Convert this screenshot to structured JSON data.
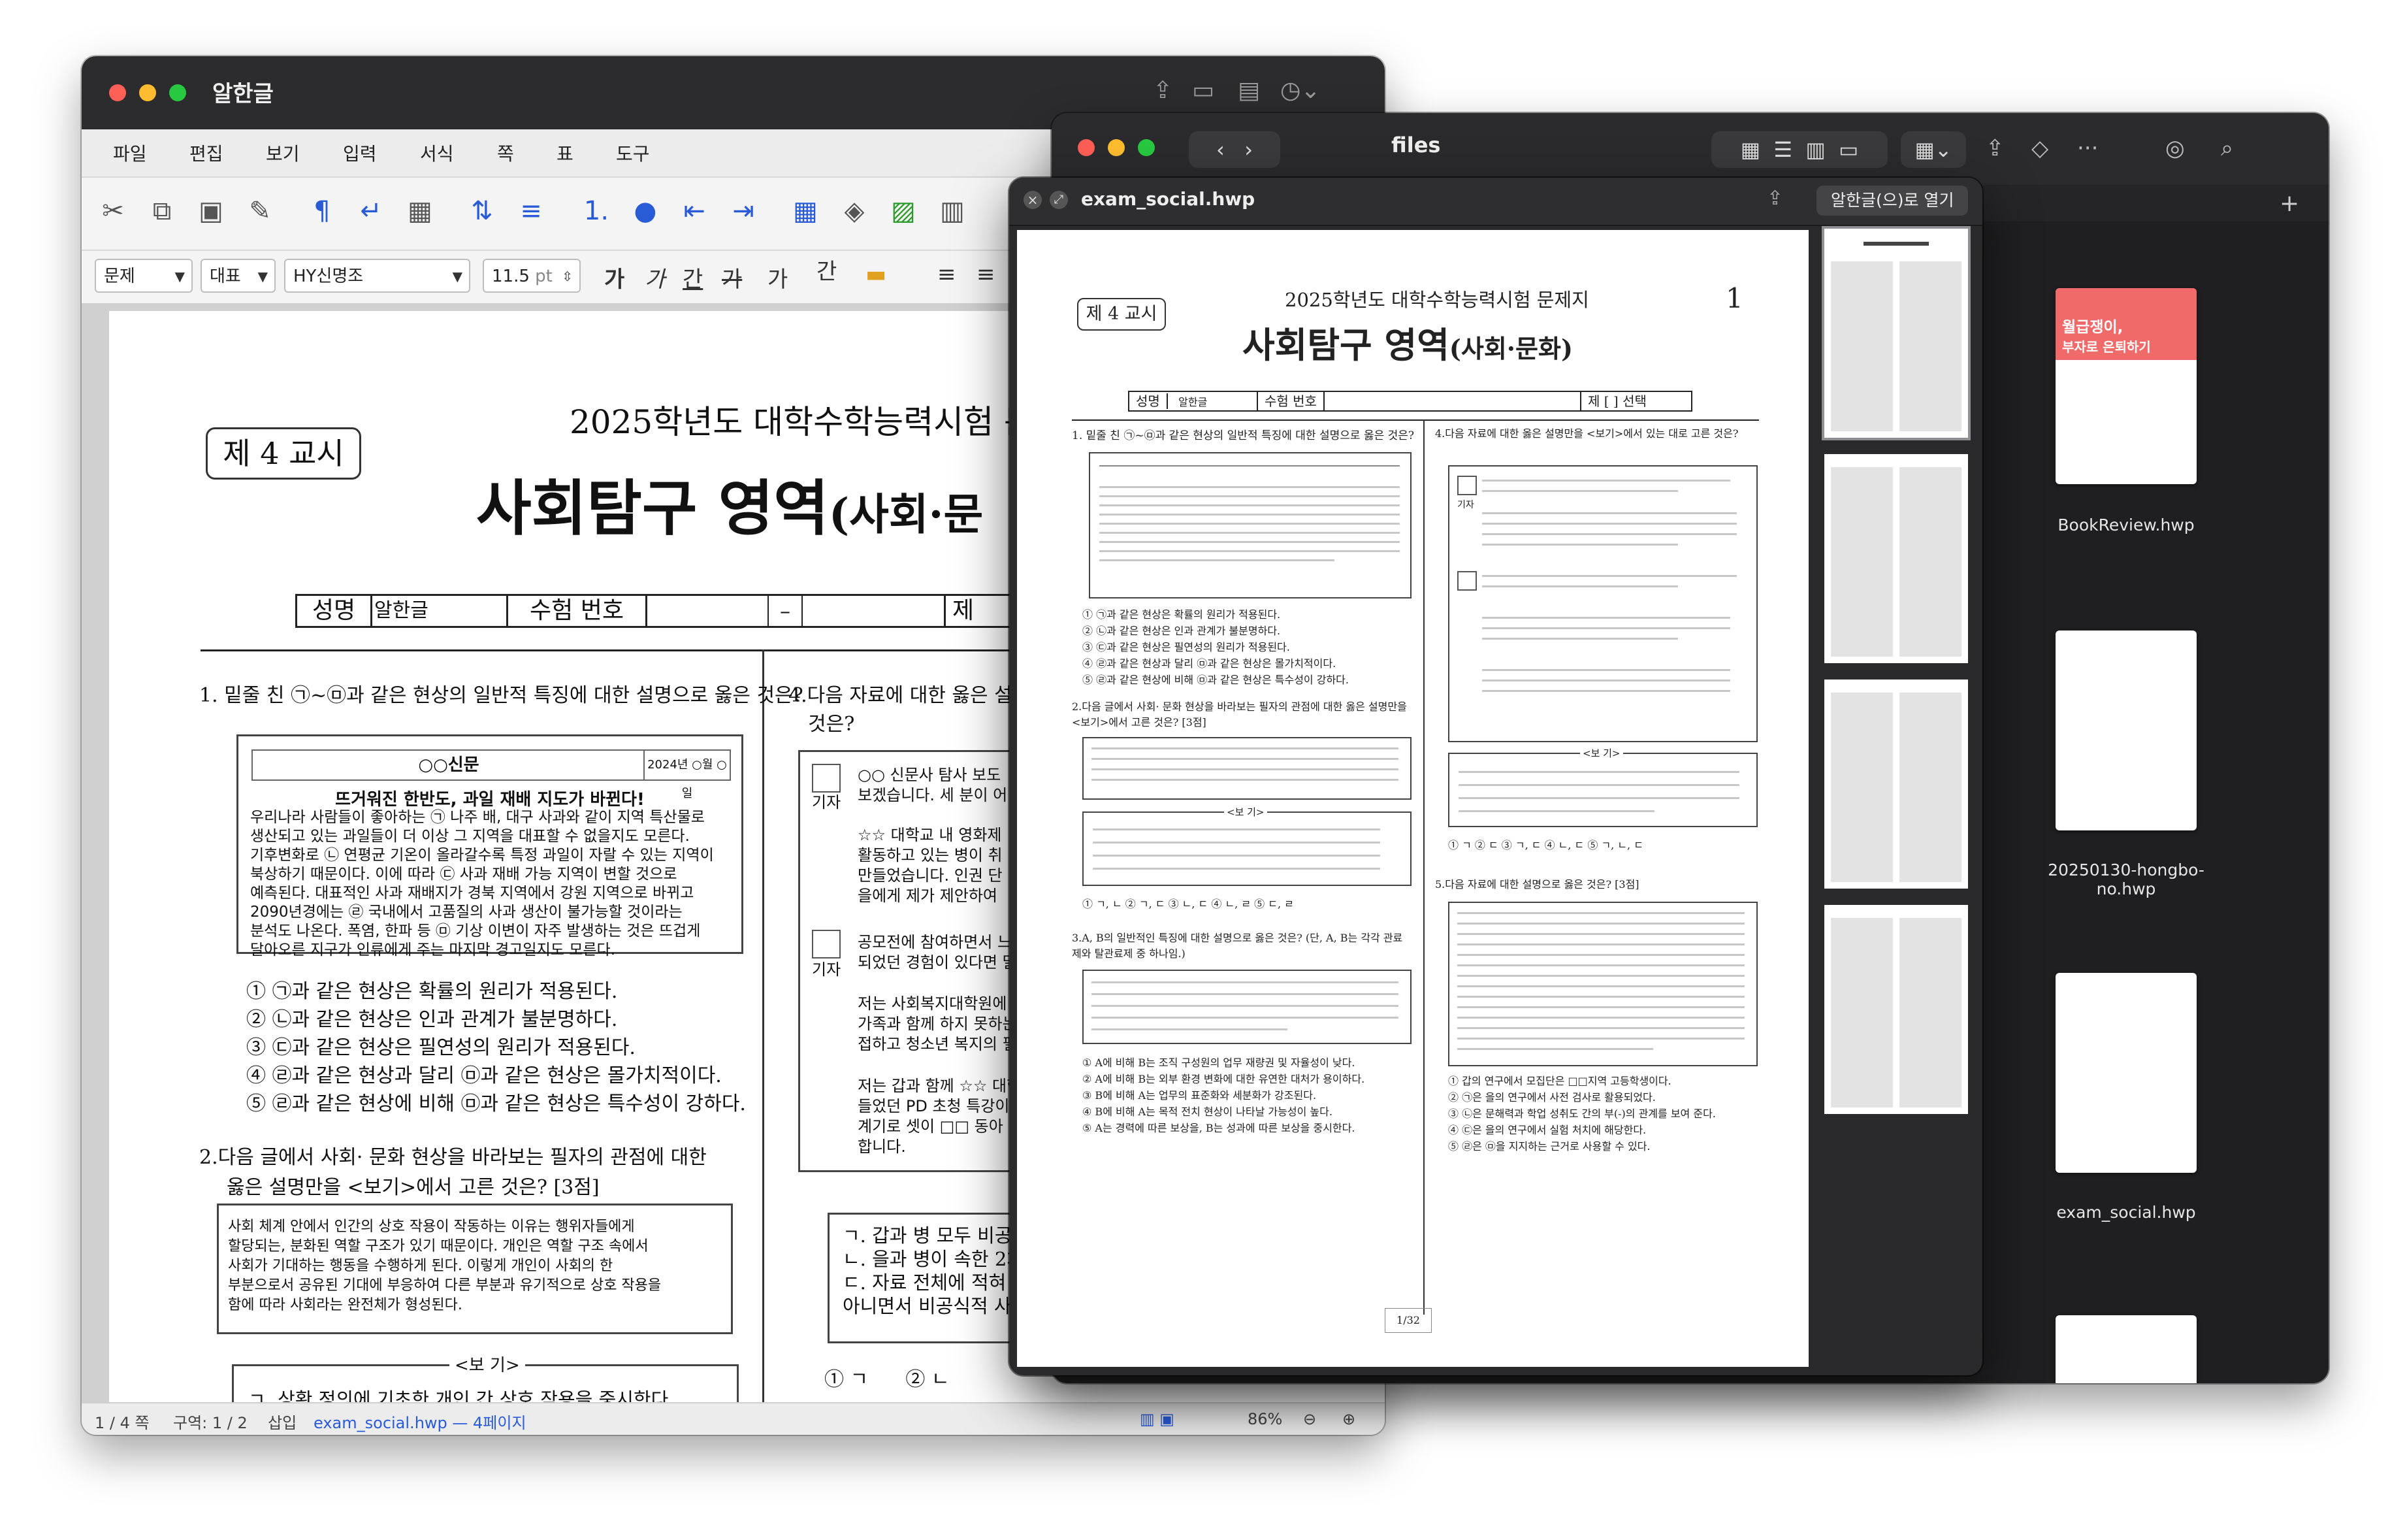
{
  "hwp_window": {
    "title": "알한글",
    "menu": [
      "파일",
      "편집",
      "보기",
      "입력",
      "서식",
      "쪽",
      "표",
      "도구"
    ],
    "format": {
      "style": "문제",
      "lang": "대표",
      "font": "HY신명조",
      "size": "11.5",
      "unit": "pt",
      "text_styles": [
        "가",
        "가",
        "간",
        "가",
        "가",
        "간"
      ]
    },
    "status": {
      "page": "1 / 4 쪽",
      "section": "구역: 1 / 2",
      "mode": "삽입",
      "doc": "exam_social.hwp — 4페이지",
      "zoom": "86%"
    },
    "exam": {
      "period": "제 4 교시",
      "header": "2025학년도 대학수학능력시험 문제지",
      "subject_main": "사회탐구 영역",
      "subject_sub": "(사회·문",
      "name_label": "성명",
      "name_value": "알한글",
      "number_label": "수험 번호",
      "dash": "–",
      "je": "제",
      "q1": "1.  밑줄 친 ㉠~㉤과 같은 현상의 일반적 특징에 대한 설명으로 옳은 것은?",
      "news_name": "○○신문",
      "news_date": "2024년 ○월 ○일",
      "news_headline": "뜨거워진 한반도, 과일 재배 지도가 바뀐다!",
      "news_body": [
        "우리나라 사람들이 좋아하는 ㉠ 나주 배, 대구 사과와 같이 지역 특산물로",
        "생산되고 있는 과일들이 더 이상 그 지역을 대표할 수 없을지도 모른다.",
        "기후변화로 ㉡ 연평균 기온이 올라갈수록 특정 과일이 자랄 수 있는 지역이",
        "북상하기 때문이다. 이에 따라 ㉢ 사과 재배 가능 지역이 변할 것으로",
        "예측된다. 대표적인 사과 재배지가 경북 지역에서 강원 지역으로 바뀌고",
        "2090년경에는 ㉣ 국내에서 고품질의 사과 생산이 불가능할 것이라는",
        "분석도 나온다. 폭염, 한파 등 ㉤ 기상 이변이 자주 발생하는 것은 뜨겁게",
        "달아오른 지구가 인류에게 주는 마지막 경고일지도 모른다."
      ],
      "q1_options": [
        "① ㉠과 같은 현상은 확률의 원리가 적용된다.",
        "② ㉡과 같은 현상은 인과 관계가 불분명하다.",
        "③ ㉢과 같은 현상은 필연성의 원리가 적용된다.",
        "④ ㉣과 같은 현상과 달리 ㉤과 같은 현상은 몰가치적이다.",
        "⑤ ㉣과 같은 현상에 비해 ㉤과 같은 현상은 특수성이 강하다."
      ],
      "q2": "2.다음 글에서 사회· 문화 현상을 바라보는 필자의 관점에 대한",
      "q2b": "옳은 설명만을 <보기>에서 고른 것은? [3점]",
      "q2_box": [
        "사회 체계 안에서 인간의 상호 작용이 작동하는 이유는 행위자들에게",
        "할당되는, 분화된 역할 구조가 있기 때문이다. 개인은 역할 구조 속에서",
        "사회가 기대하는 행동을 수행하게 된다. 이렇게 개인이 사회의 한",
        "부분으로서 공유된 기대에 부응하여 다른 부분과 유기적으로 상호 작용을",
        "함에 따라 사회라는 완전체가 형성된다."
      ],
      "bogi": "<보 기>",
      "q2_bogi1": "ㄱ. 상황 정의에 기초한 개인 간 상호 작용을 중시한다.",
      "q4": "4.다음 자료에 대한 옳은 설",
      "q4b": "것은?",
      "q4_speaker1_text": [
        "○○ 신문사 탐사 보도",
        "보겠습니다. 세 분이 어"
      ],
      "q4_speaker2_text": [
        "☆☆ 대학교 내 영화제",
        "활동하고 있는 병이 취",
        "만들었습니다. 인권 단",
        "을에게 제가 제안하여"
      ],
      "q4_speaker3_text": [
        "공모전에 참여하면서 느",
        "되었던 경험이 있다면 말"
      ],
      "q4_speaker4_text": [
        "저는 사회복지대학원에",
        "가족과 함께 하지 못하는",
        "접하고 청소년 복지의 필"
      ],
      "q4_speaker5_text": [
        "저는 갑과 함께 ☆☆ 대학",
        "들었던 PD 초청 특강이",
        "계기로 셋이 □□ 동아",
        "합니다."
      ],
      "reporter": "기자",
      "q4_bogi": [
        "ㄱ. 갑과 병 모두 비공식",
        "ㄴ. 을과 병이 속한 2차",
        "ㄷ. 자료 전체에 적혀 있",
        "아니면서 비공식적 사회"
      ],
      "q4_opts": [
        "① ㄱ",
        "② ㄴ"
      ],
      "q5_partial": "5.다음 자료에 대한 설명으로 옳은 것은? [3점]"
    }
  },
  "finder_window": {
    "title": "files",
    "files": [
      {
        "name": "BookReview.hwp",
        "thumb_title": "월급쟁이,",
        "thumb_sub": "부자로 은퇴하기"
      },
      {
        "name": "20250130-hongbo-no.hwp"
      },
      {
        "name": "exam_social.hwp"
      }
    ]
  },
  "quicklook": {
    "filename": "exam_social.hwp",
    "open_with": "알한글(으)로 열기",
    "page_header": "2025학년도 대학수학능력시험 문제지",
    "page_num": "1",
    "period": "제 4 교시",
    "subject": "사회탐구 영역",
    "subject_sub": "(사회·문화)",
    "name_label": "성명",
    "name_value": "알한글",
    "number_label": "수험 번호",
    "je": "제 [ ] 선택",
    "q1": "1.  밑줄 친 ㉠~㉤과 같은 현상의 일반적 특징에 대한 설명으로 옳은 것은?",
    "q4": "4.다음 자료에 대한 옳은 설명만을 <보기>에서 있는 대로 고른 것은?",
    "q2": "2.다음 글에서 사회· 문화 현상을 바라보는 필자의 관점에 대한 옳은 설명만을 <보기>에서 고른 것은? [3점]",
    "q3": "3.A, B의 일반적인 특징에 대한 설명으로 옳은 것은? (단, A, B는 각각 관료제와 탈관료제 중 하나임.)",
    "q5": "5.다음 자료에 대한 설명으로 옳은 것은? [3점]",
    "q1_options": [
      "① ㉠과 같은 현상은 확률의 원리가 적용된다.",
      "② ㉡과 같은 현상은 인과 관계가 불분명하다.",
      "③ ㉢과 같은 현상은 필연성의 원리가 적용된다.",
      "④ ㉣과 같은 현상과 달리 ㉤과 같은 현상은 몰가치적이다.",
      "⑤ ㉣과 같은 현상에 비해 ㉤과 같은 현상은 특수성이 강하다."
    ],
    "q2_options": "① ㄱ, ㄴ    ② ㄱ, ㄷ    ③ ㄴ, ㄷ    ④ ㄴ, ㄹ    ⑤ ㄷ, ㄹ",
    "q3_options": [
      "① A에 비해 B는 조직 구성원의 업무 재량권 및 자율성이 낮다.",
      "② A에 비해 B는 외부 환경 변화에 대한 유연한 대처가 용이하다.",
      "③ B에 비해 A는 업무의 표준화와 세분화가 강조된다.",
      "④ B에 비해 A는 목적 전치 현상이 나타날 가능성이 높다.",
      "⑤ A는 경력에 따른 보상을, B는 성과에 따른 보상을 중시한다."
    ],
    "q4_options": "① ㄱ     ② ㄷ     ③ ㄱ, ㄷ     ④ ㄴ, ㄷ     ⑤ ㄱ, ㄴ, ㄷ",
    "q5_options": [
      "① 갑의 연구에서 모집단은 □□지역 고등학생이다.",
      "② ㉠은 을의 연구에서 사전 검사로 활용되었다.",
      "③ ㉡은 문해력과 학업 성취도 간의 부(-)의 관계를 보여 준다.",
      "④ ㉢은 을의 연구에서 실험 처치에 해당한다.",
      "⑤ ㉣은 ㉤을 지지하는 근거로 사용할 수 있다."
    ],
    "footer": "1/32",
    "bogi": "<보 기>",
    "speaker_gi": "기자"
  },
  "colors": {
    "accent": "#2a5bd7",
    "tl_red": "#fe5f57",
    "tl_yellow": "#febc2e",
    "tl_green": "#28c840"
  }
}
